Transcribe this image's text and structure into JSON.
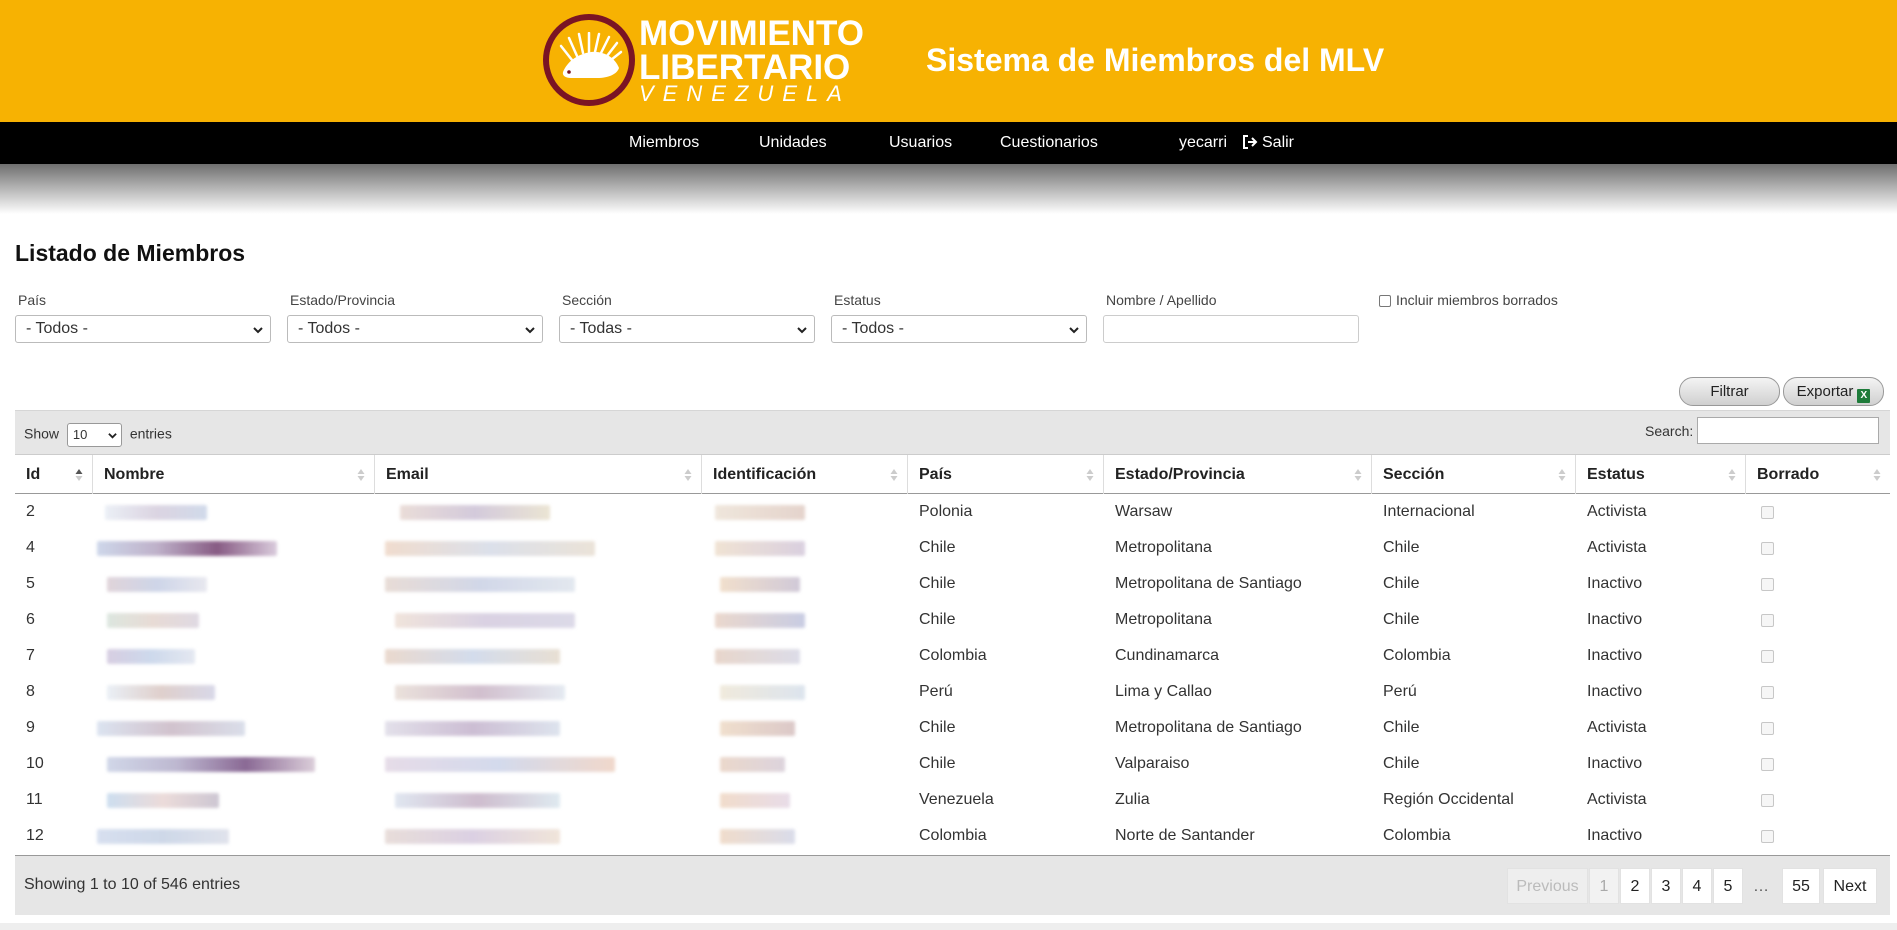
{
  "header": {
    "logo_line1": "MOVIMIENTO",
    "logo_line2": "LIBERTARIO",
    "logo_line3": "VENEZUELA",
    "title": "Sistema de Miembros del MLV",
    "bg_color": "#f7b202"
  },
  "nav": {
    "items": [
      "Miembros",
      "Unidades",
      "Usuarios",
      "Cuestionarios"
    ],
    "user": "yecarri",
    "logout": "Salir"
  },
  "page": {
    "title": "Listado de Miembros"
  },
  "filters": {
    "pais_label": "País",
    "pais_value": "- Todos -",
    "estado_label": "Estado/Provincia",
    "estado_value": "- Todos -",
    "seccion_label": "Sección",
    "seccion_value": "- Todas -",
    "estatus_label": "Estatus",
    "estatus_value": "- Todos -",
    "nombre_label": "Nombre / Apellido",
    "nombre_value": "",
    "borrados_label": "Incluir miembros borrados",
    "borrados_checked": false
  },
  "buttons": {
    "filtrar": "Filtrar",
    "exportar": "Exportar",
    "exportar_icon": "excel-icon"
  },
  "table": {
    "show_label": "Show",
    "length_value": "10",
    "entries_label": "entries",
    "search_label": "Search:",
    "columns": [
      "Id",
      "Nombre",
      "Email",
      "Identificación",
      "País",
      "Estado/Provincia",
      "Sección",
      "Estatus",
      "Borrado"
    ],
    "rows": [
      {
        "id": "2",
        "pais": "Polonia",
        "estado": "Warsaw",
        "seccion": "Internacional",
        "estatus": "Activista"
      },
      {
        "id": "4",
        "pais": "Chile",
        "estado": "Metropolitana",
        "seccion": "Chile",
        "estatus": "Activista"
      },
      {
        "id": "5",
        "pais": "Chile",
        "estado": "Metropolitana de Santiago",
        "seccion": "Chile",
        "estatus": "Inactivo"
      },
      {
        "id": "6",
        "pais": "Chile",
        "estado": "Metropolitana",
        "seccion": "Chile",
        "estatus": "Inactivo"
      },
      {
        "id": "7",
        "pais": "Colombia",
        "estado": "Cundinamarca",
        "seccion": "Colombia",
        "estatus": "Inactivo"
      },
      {
        "id": "8",
        "pais": "Perú",
        "estado": "Lima y Callao",
        "seccion": "Perú",
        "estatus": "Inactivo"
      },
      {
        "id": "9",
        "pais": "Chile",
        "estado": "Metropolitana de Santiago",
        "seccion": "Chile",
        "estatus": "Activista"
      },
      {
        "id": "10",
        "pais": "Chile",
        "estado": "Valparaiso",
        "seccion": "Chile",
        "estatus": "Inactivo"
      },
      {
        "id": "11",
        "pais": "Venezuela",
        "estado": "Zulia",
        "seccion": "Región Occidental",
        "estatus": "Activista"
      },
      {
        "id": "12",
        "pais": "Colombia",
        "estado": "Norte de Santander",
        "seccion": "Colombia",
        "estatus": "Inactivo"
      }
    ],
    "info": "Showing 1 to 10 of 546 entries",
    "pagination": {
      "previous": "Previous",
      "pages": [
        "1",
        "2",
        "3",
        "4",
        "5"
      ],
      "ellipsis": "…",
      "last": "55",
      "next": "Next",
      "current": "1"
    }
  }
}
